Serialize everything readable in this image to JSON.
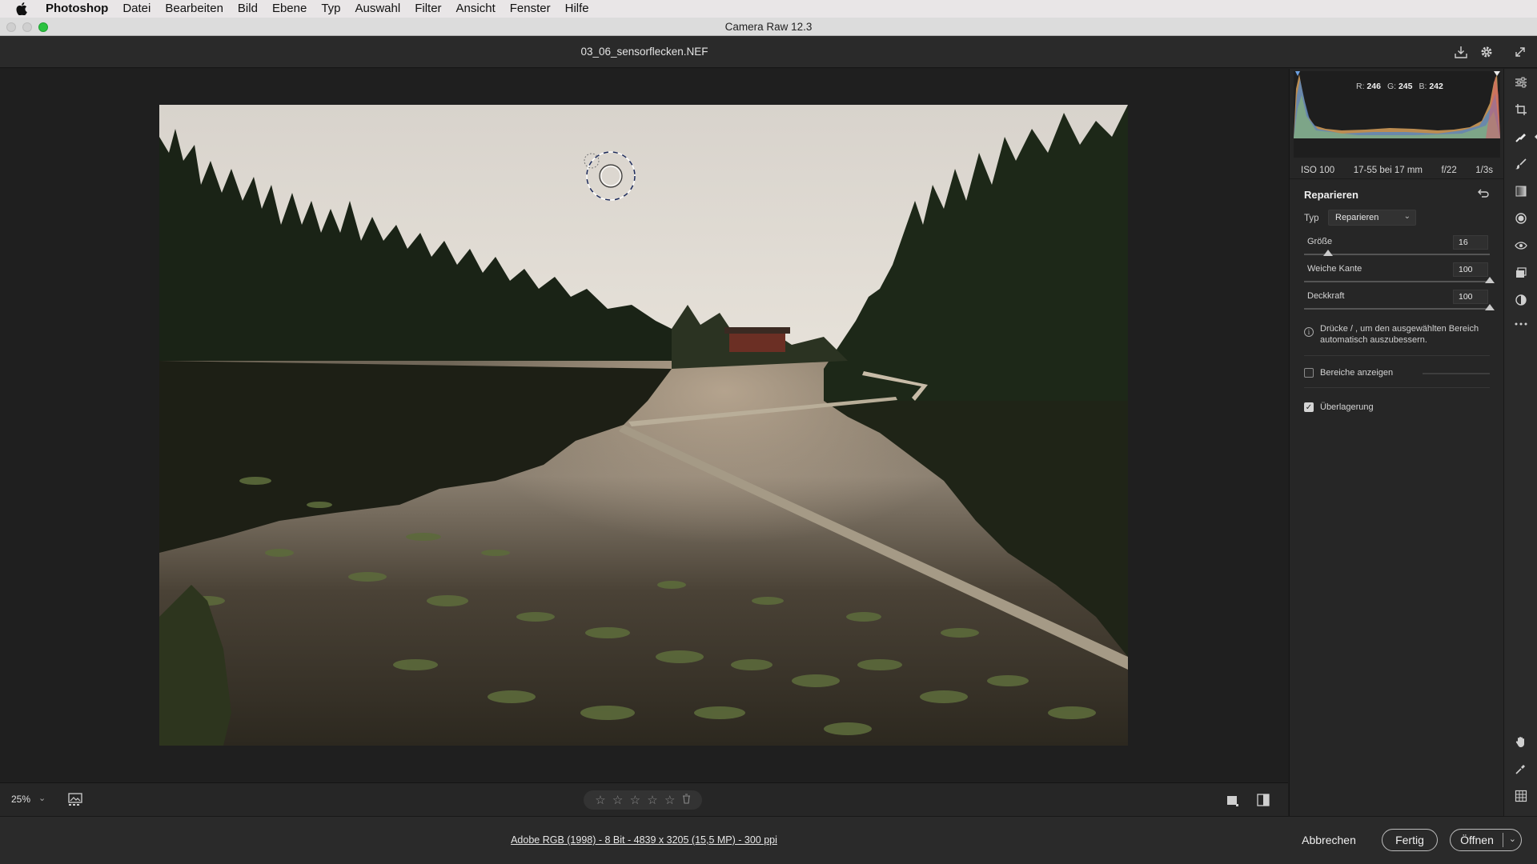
{
  "menubar": {
    "app": "Photoshop",
    "items": [
      "Datei",
      "Bearbeiten",
      "Bild",
      "Ebene",
      "Typ",
      "Auswahl",
      "Filter",
      "Ansicht",
      "Fenster",
      "Hilfe"
    ]
  },
  "window": {
    "title": "Camera Raw 12.3"
  },
  "document": {
    "filename": "03_06_sensorflecken.NEF"
  },
  "histogram": {
    "r_label": "R:",
    "r": "246",
    "g_label": "G:",
    "g": "245",
    "b_label": "B:",
    "b": "242"
  },
  "exif": {
    "iso": "ISO 100",
    "lens": "17-55 bei 17 mm",
    "aperture": "f/22",
    "shutter": "1/3s"
  },
  "panel": {
    "title": "Reparieren",
    "type_label": "Typ",
    "type_value": "Reparieren",
    "sliders": [
      {
        "label": "Größe",
        "value": "16",
        "fraction": 0.13
      },
      {
        "label": "Weiche Kante",
        "value": "100",
        "fraction": 1.0
      },
      {
        "label": "Deckkraft",
        "value": "100",
        "fraction": 1.0
      }
    ],
    "info_text": "Drücke / , um den ausgewählten Bereich automatisch auszubessern.",
    "show_areas_label": "Bereiche anzeigen",
    "show_areas_checked": false,
    "overlay_label": "Überlagerung",
    "overlay_checked": true
  },
  "bottombar": {
    "zoom": "25%",
    "stars": 5,
    "rating": 0
  },
  "footer": {
    "workflow": "Adobe RGB (1998) - 8 Bit - 4839 x 3205 (15,5 MP) - 300 ppi",
    "cancel": "Abbrechen",
    "done": "Fertig",
    "open": "Öffnen"
  },
  "colors": {
    "accent": "#2bc23f",
    "panel_bg": "#262626",
    "canvas_bg": "#1f1f1f"
  },
  "icons": {
    "tools": [
      "edit-sliders-icon",
      "crop-icon",
      "spot-removal-icon",
      "adjustment-brush-icon",
      "graduated-filter-icon",
      "radial-filter-icon",
      "red-eye-icon",
      "snapshots-icon",
      "presets-icon",
      "more-icon",
      "hand-icon",
      "color-sampler-icon",
      "grid-icon"
    ]
  }
}
